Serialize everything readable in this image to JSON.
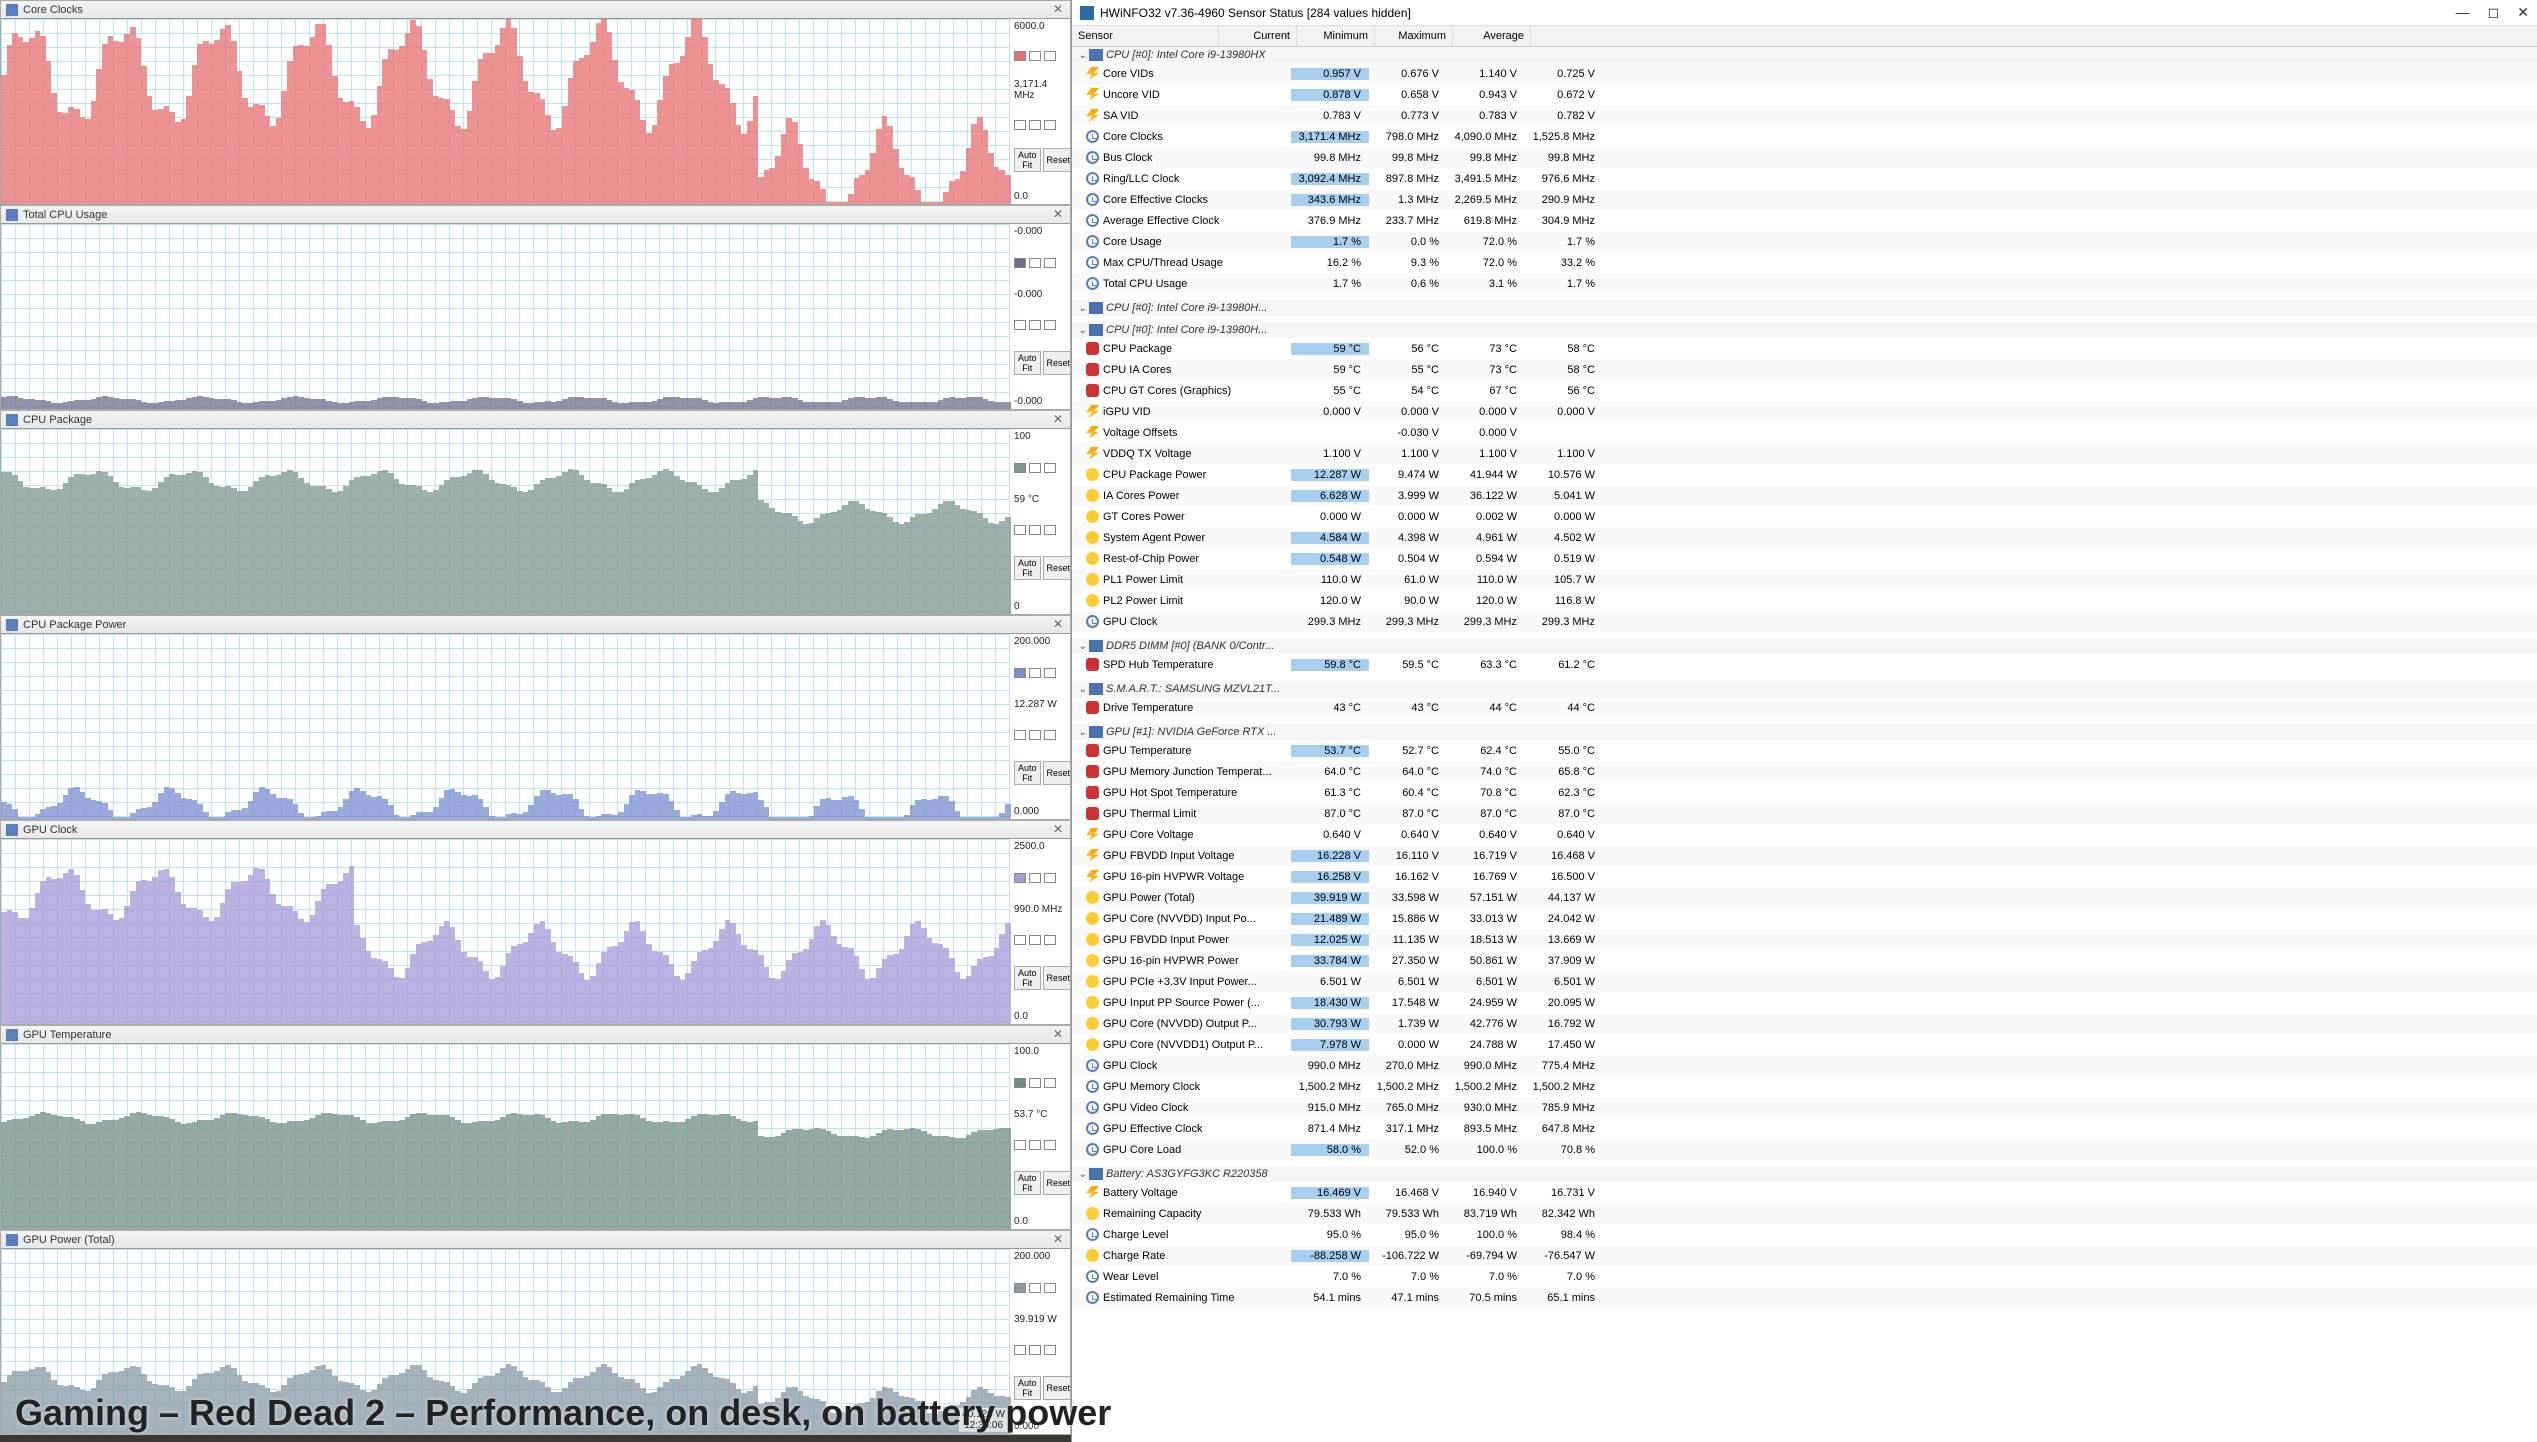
{
  "window_title": "HWiNFO32 v7.36-4960 Sensor Status [284 values hidden]",
  "caption": "Gaming – Red Dead 2 – Performance, on desk, on battery power",
  "time_box": {
    "val": "40.126 W",
    "time": "12:35:06"
  },
  "charts": [
    {
      "title": "Core Clocks",
      "max": "6000.0",
      "cur": "3,171.4 MHz",
      "min": "0.0",
      "color": "#e76f6f",
      "fill": 0.7,
      "variance": 0.5,
      "drop_at": 0.75,
      "drop_to": 0.15
    },
    {
      "title": "Total CPU Usage",
      "max": "-0.000",
      "cur": "-0.000",
      "min": "-0.000",
      "color": "#6e6e8e",
      "fill": 0.05,
      "variance": 0.03,
      "drop_at": 1,
      "drop_to": 0.05
    },
    {
      "title": "CPU Package",
      "max": "100",
      "cur": "59 °C",
      "min": "0",
      "color": "#7c9690",
      "fill": 0.72,
      "variance": 0.1,
      "drop_at": 0.75,
      "drop_to": 0.55
    },
    {
      "title": "CPU Package Power",
      "max": "200.000",
      "cur": "12.287 W",
      "min": "0.000",
      "color": "#7a8dd0",
      "fill": 0.08,
      "variance": 0.15,
      "drop_at": 0.75,
      "drop_to": 0.05
    },
    {
      "title": "GPU Clock",
      "max": "2500.0",
      "cur": "990.0 MHz",
      "min": "0.0",
      "color": "#a79ad9",
      "fill": 0.7,
      "variance": 0.25,
      "drop_at": 0.35,
      "drop_to": 0.4
    },
    {
      "title": "GPU Temperature",
      "max": "100.0",
      "cur": "53.7 °C",
      "min": "0.0",
      "color": "#6f8f85",
      "fill": 0.6,
      "variance": 0.05,
      "drop_at": 0.75,
      "drop_to": 0.52
    },
    {
      "title": "GPU Power (Total)",
      "max": "200.000",
      "cur": "39.919 W",
      "min": "0.000",
      "color": "#8a9aa5",
      "fill": 0.3,
      "variance": 0.12,
      "drop_at": 0.75,
      "drop_to": 0.18
    }
  ],
  "chart_data": [
    {
      "type": "line",
      "title": "Core Clocks",
      "ylabel": "MHz",
      "ylim": [
        0,
        6000
      ],
      "current": 3171.4
    },
    {
      "type": "line",
      "title": "Total CPU Usage",
      "ylabel": "%",
      "ylim": [
        0,
        100
      ],
      "current": 0
    },
    {
      "type": "line",
      "title": "CPU Package",
      "ylabel": "°C",
      "ylim": [
        0,
        100
      ],
      "current": 59
    },
    {
      "type": "line",
      "title": "CPU Package Power",
      "ylabel": "W",
      "ylim": [
        0,
        200
      ],
      "current": 12.287
    },
    {
      "type": "line",
      "title": "GPU Clock",
      "ylabel": "MHz",
      "ylim": [
        0,
        2500
      ],
      "current": 990.0
    },
    {
      "type": "line",
      "title": "GPU Temperature",
      "ylabel": "°C",
      "ylim": [
        0,
        100
      ],
      "current": 53.7
    },
    {
      "type": "line",
      "title": "GPU Power (Total)",
      "ylabel": "W",
      "ylim": [
        0,
        200
      ],
      "current": 39.919
    }
  ],
  "cols": {
    "sensor": "Sensor",
    "current": "Current",
    "minimum": "Minimum",
    "maximum": "Maximum",
    "average": "Average"
  },
  "btn_autofit": "Auto Fit",
  "btn_reset": "Reset",
  "groups": [
    {
      "name": "CPU [#0]: Intel Core i9-13980HX",
      "rows": [
        {
          "ic": "bolt",
          "n": "Core VIDs",
          "c": "0.957 V",
          "mi": "0.676 V",
          "ma": "1.140 V",
          "av": "0.725 V",
          "hl": 1
        },
        {
          "ic": "bolt",
          "n": "Uncore VID",
          "c": "0.878 V",
          "mi": "0.658 V",
          "ma": "0.943 V",
          "av": "0.672 V",
          "hl": 1
        },
        {
          "ic": "bolt",
          "n": "SA VID",
          "c": "0.783 V",
          "mi": "0.773 V",
          "ma": "0.783 V",
          "av": "0.782 V"
        },
        {
          "ic": "clock",
          "n": "Core Clocks",
          "c": "3,171.4 MHz",
          "mi": "798.0 MHz",
          "ma": "4,090.0 MHz",
          "av": "1,525.8 MHz",
          "hl": 1
        },
        {
          "ic": "clock",
          "n": "Bus Clock",
          "c": "99.8 MHz",
          "mi": "99.8 MHz",
          "ma": "99.8 MHz",
          "av": "99.8 MHz"
        },
        {
          "ic": "clock",
          "n": "Ring/LLC Clock",
          "c": "3,092.4 MHz",
          "mi": "897.8 MHz",
          "ma": "3,491.5 MHz",
          "av": "976.6 MHz",
          "hl": 1
        },
        {
          "ic": "clock",
          "n": "Core Effective Clocks",
          "c": "343.6 MHz",
          "mi": "1.3 MHz",
          "ma": "2,269.5 MHz",
          "av": "290.9 MHz",
          "hl": 1
        },
        {
          "ic": "clock",
          "n": "Average Effective Clock",
          "c": "376.9 MHz",
          "mi": "233.7 MHz",
          "ma": "619.8 MHz",
          "av": "304.9 MHz"
        },
        {
          "ic": "clock",
          "n": "Core Usage",
          "c": "1.7 %",
          "mi": "0.0 %",
          "ma": "72.0 %",
          "av": "1.7 %",
          "hl": 1
        },
        {
          "ic": "clock",
          "n": "Max CPU/Thread Usage",
          "c": "16.2 %",
          "mi": "9.3 %",
          "ma": "72.0 %",
          "av": "33.2 %"
        },
        {
          "ic": "clock",
          "n": "Total CPU Usage",
          "c": "1.7 %",
          "mi": "0.6 %",
          "ma": "3.1 %",
          "av": "1.7 %"
        }
      ]
    },
    {
      "name": "CPU [#0]: Intel Core i9-13980H...",
      "rows": []
    },
    {
      "name": "CPU [#0]: Intel Core i9-13980H...",
      "rows": [
        {
          "ic": "temp",
          "n": "CPU Package",
          "c": "59 °C",
          "mi": "56 °C",
          "ma": "73 °C",
          "av": "58 °C",
          "hl": 1
        },
        {
          "ic": "temp",
          "n": "CPU IA Cores",
          "c": "59 °C",
          "mi": "55 °C",
          "ma": "73 °C",
          "av": "58 °C"
        },
        {
          "ic": "temp",
          "n": "CPU GT Cores (Graphics)",
          "c": "55 °C",
          "mi": "54 °C",
          "ma": "67 °C",
          "av": "56 °C"
        },
        {
          "ic": "bolt",
          "n": "iGPU VID",
          "c": "0.000 V",
          "mi": "0.000 V",
          "ma": "0.000 V",
          "av": "0.000 V"
        },
        {
          "ic": "bolt",
          "n": "Voltage Offsets",
          "c": "",
          "mi": "-0.030 V",
          "ma": "0.000 V",
          "av": ""
        },
        {
          "ic": "bolt",
          "n": "VDDQ TX Voltage",
          "c": "1.100 V",
          "mi": "1.100 V",
          "ma": "1.100 V",
          "av": "1.100 V"
        },
        {
          "ic": "watt",
          "n": "CPU Package Power",
          "c": "12.287 W",
          "mi": "9.474 W",
          "ma": "41.944 W",
          "av": "10.576 W",
          "hl": 1
        },
        {
          "ic": "watt",
          "n": "IA Cores Power",
          "c": "6.628 W",
          "mi": "3.999 W",
          "ma": "36.122 W",
          "av": "5.041 W",
          "hl": 1
        },
        {
          "ic": "watt",
          "n": "GT Cores Power",
          "c": "0.000 W",
          "mi": "0.000 W",
          "ma": "0.002 W",
          "av": "0.000 W"
        },
        {
          "ic": "watt",
          "n": "System Agent Power",
          "c": "4.584 W",
          "mi": "4.398 W",
          "ma": "4.961 W",
          "av": "4.502 W",
          "hl": 1
        },
        {
          "ic": "watt",
          "n": "Rest-of-Chip Power",
          "c": "0.548 W",
          "mi": "0.504 W",
          "ma": "0.594 W",
          "av": "0.519 W",
          "hl": 1
        },
        {
          "ic": "watt",
          "n": "PL1 Power Limit",
          "c": "110.0 W",
          "mi": "61.0 W",
          "ma": "110.0 W",
          "av": "105.7 W"
        },
        {
          "ic": "watt",
          "n": "PL2 Power Limit",
          "c": "120.0 W",
          "mi": "90.0 W",
          "ma": "120.0 W",
          "av": "116.8 W"
        },
        {
          "ic": "clock",
          "n": "GPU Clock",
          "c": "299.3 MHz",
          "mi": "299.3 MHz",
          "ma": "299.3 MHz",
          "av": "299.3 MHz"
        }
      ]
    },
    {
      "name": "DDR5 DIMM [#0] (BANK 0/Contr...",
      "rows": [
        {
          "ic": "temp",
          "n": "SPD Hub Temperature",
          "c": "59.8 °C",
          "mi": "59.5 °C",
          "ma": "63.3 °C",
          "av": "61.2 °C",
          "hl": 1
        }
      ]
    },
    {
      "name": "S.M.A.R.T.: SAMSUNG MZVL21T...",
      "rows": [
        {
          "ic": "temp",
          "n": "Drive Temperature",
          "c": "43 °C",
          "mi": "43 °C",
          "ma": "44 °C",
          "av": "44 °C"
        }
      ]
    },
    {
      "name": "GPU [#1]: NVIDIA GeForce RTX ...",
      "rows": [
        {
          "ic": "temp",
          "n": "GPU Temperature",
          "c": "53.7 °C",
          "mi": "52.7 °C",
          "ma": "62.4 °C",
          "av": "55.0 °C",
          "hl": 1
        },
        {
          "ic": "temp",
          "n": "GPU Memory Junction Temperat...",
          "c": "64.0 °C",
          "mi": "64.0 °C",
          "ma": "74.0 °C",
          "av": "65.8 °C"
        },
        {
          "ic": "temp",
          "n": "GPU Hot Spot Temperature",
          "c": "61.3 °C",
          "mi": "60.4 °C",
          "ma": "70.8 °C",
          "av": "62.3 °C"
        },
        {
          "ic": "temp",
          "n": "GPU Thermal Limit",
          "c": "87.0 °C",
          "mi": "87.0 °C",
          "ma": "87.0 °C",
          "av": "87.0 °C"
        },
        {
          "ic": "bolt",
          "n": "GPU Core Voltage",
          "c": "0.640 V",
          "mi": "0.640 V",
          "ma": "0.640 V",
          "av": "0.640 V"
        },
        {
          "ic": "bolt",
          "n": "GPU FBVDD Input Voltage",
          "c": "16.228 V",
          "mi": "16.110 V",
          "ma": "16.719 V",
          "av": "16.468 V",
          "hl": 1
        },
        {
          "ic": "bolt",
          "n": "GPU 16-pin HVPWR Voltage",
          "c": "16.258 V",
          "mi": "16.162 V",
          "ma": "16.769 V",
          "av": "16.500 V",
          "hl": 1
        },
        {
          "ic": "watt",
          "n": "GPU Power (Total)",
          "c": "39.919 W",
          "mi": "33.598 W",
          "ma": "57.151 W",
          "av": "44.137 W",
          "hl": 1
        },
        {
          "ic": "watt",
          "n": "GPU Core (NVVDD) Input Po...",
          "c": "21.489 W",
          "mi": "15.886 W",
          "ma": "33.013 W",
          "av": "24.042 W",
          "hl": 1
        },
        {
          "ic": "watt",
          "n": "GPU FBVDD Input Power",
          "c": "12.025 W",
          "mi": "11.135 W",
          "ma": "18.513 W",
          "av": "13.669 W",
          "hl": 1
        },
        {
          "ic": "watt",
          "n": "GPU 16-pin HVPWR Power",
          "c": "33.784 W",
          "mi": "27.350 W",
          "ma": "50.861 W",
          "av": "37.909 W",
          "hl": 1
        },
        {
          "ic": "watt",
          "n": "GPU PCIe +3.3V Input Power...",
          "c": "6.501 W",
          "mi": "6.501 W",
          "ma": "6.501 W",
          "av": "6.501 W"
        },
        {
          "ic": "watt",
          "n": "GPU Input PP Source Power (...",
          "c": "18.430 W",
          "mi": "17.548 W",
          "ma": "24.959 W",
          "av": "20.095 W",
          "hl": 1
        },
        {
          "ic": "watt",
          "n": "GPU Core (NVVDD) Output P...",
          "c": "30.793 W",
          "mi": "1.739 W",
          "ma": "42.776 W",
          "av": "16.792 W",
          "hl": 1
        },
        {
          "ic": "watt",
          "n": "GPU Core (NVVDD1) Output P...",
          "c": "7.978 W",
          "mi": "0.000 W",
          "ma": "24.788 W",
          "av": "17.450 W",
          "hl": 1
        },
        {
          "ic": "clock",
          "n": "GPU Clock",
          "c": "990.0 MHz",
          "mi": "270.0 MHz",
          "ma": "990.0 MHz",
          "av": "775.4 MHz"
        },
        {
          "ic": "clock",
          "n": "GPU Memory Clock",
          "c": "1,500.2 MHz",
          "mi": "1,500.2 MHz",
          "ma": "1,500.2 MHz",
          "av": "1,500.2 MHz"
        },
        {
          "ic": "clock",
          "n": "GPU Video Clock",
          "c": "915.0 MHz",
          "mi": "765.0 MHz",
          "ma": "930.0 MHz",
          "av": "785.9 MHz"
        },
        {
          "ic": "clock",
          "n": "GPU Effective Clock",
          "c": "871.4 MHz",
          "mi": "317.1 MHz",
          "ma": "893.5 MHz",
          "av": "647.8 MHz"
        },
        {
          "ic": "clock",
          "n": "GPU Core Load",
          "c": "58.0 %",
          "mi": "52.0 %",
          "ma": "100.0 %",
          "av": "70.8 %",
          "hl": 1
        }
      ]
    },
    {
      "name": "Battery: AS3GYFG3KC R220358",
      "rows": [
        {
          "ic": "bolt",
          "n": "Battery Voltage",
          "c": "16.469 V",
          "mi": "16.468 V",
          "ma": "16.940 V",
          "av": "16.731 V",
          "hl": 1
        },
        {
          "ic": "watt",
          "n": "Remaining Capacity",
          "c": "79.533 Wh",
          "mi": "79.533 Wh",
          "ma": "83.719 Wh",
          "av": "82.342 Wh"
        },
        {
          "ic": "clock",
          "n": "Charge Level",
          "c": "95.0 %",
          "mi": "95.0 %",
          "ma": "100.0 %",
          "av": "98.4 %"
        },
        {
          "ic": "watt",
          "n": "Charge Rate",
          "c": "-88.258 W",
          "mi": "-106.722 W",
          "ma": "-69.794 W",
          "av": "-76.547 W",
          "hl": 1
        },
        {
          "ic": "clock",
          "n": "Wear Level",
          "c": "7.0 %",
          "mi": "7.0 %",
          "ma": "7.0 %",
          "av": "7.0 %"
        },
        {
          "ic": "clock",
          "n": "Estimated Remaining Time",
          "c": "54.1 mins",
          "mi": "47.1 mins",
          "ma": "70.5 mins",
          "av": "65.1 mins"
        }
      ]
    }
  ]
}
